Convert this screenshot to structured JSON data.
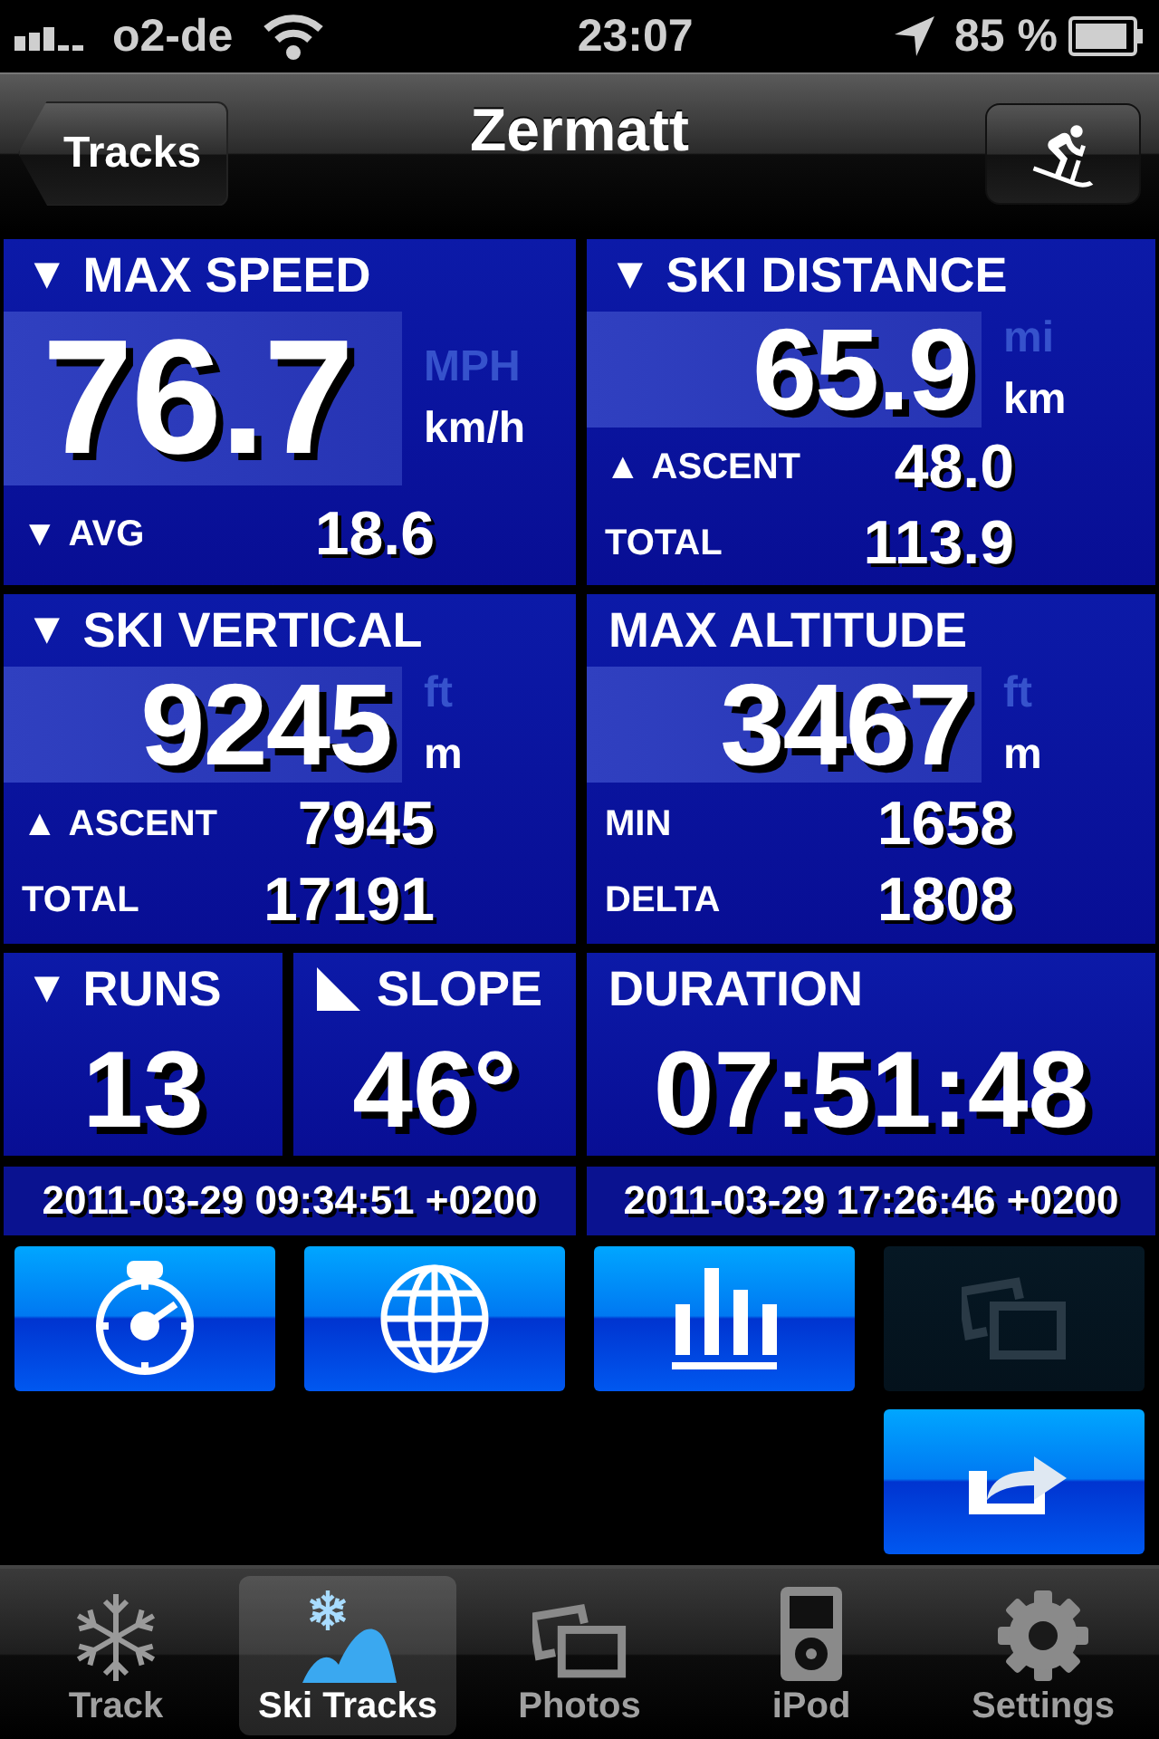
{
  "status_bar": {
    "carrier": "o2-de",
    "time": "23:07",
    "battery": "85 %"
  },
  "nav": {
    "back": "Tracks",
    "title": "Zermatt"
  },
  "stats": [
    {
      "marker": "▼",
      "title": "MAX SPEED",
      "value": "76.7",
      "units": [
        {
          "label": "MPH",
          "selected": false
        },
        {
          "label": "km/h",
          "selected": true
        }
      ],
      "rows": [
        {
          "marker": "▼",
          "label": "AVG",
          "value": "18.6"
        }
      ]
    },
    {
      "marker": "▼",
      "title": "SKI DISTANCE",
      "value": "65.9",
      "units": [
        {
          "label": "mi",
          "selected": false
        },
        {
          "label": "km",
          "selected": true
        }
      ],
      "rows": [
        {
          "marker": "▲",
          "label": "ASCENT",
          "value": "48.0"
        },
        {
          "label": "TOTAL",
          "value": "113.9"
        }
      ]
    },
    {
      "marker": "▼",
      "title": "SKI VERTICAL",
      "value": "9245",
      "units": [
        {
          "label": "ft",
          "selected": false
        },
        {
          "label": "m",
          "selected": true
        }
      ],
      "rows": [
        {
          "marker": "▲",
          "label": "ASCENT",
          "value": "7945"
        },
        {
          "label": "TOTAL",
          "value": "17191"
        }
      ]
    },
    {
      "title": "MAX ALTITUDE",
      "value": "3467",
      "units": [
        {
          "label": "ft",
          "selected": false
        },
        {
          "label": "m",
          "selected": true
        }
      ],
      "rows": [
        {
          "label": "MIN",
          "value": "1658"
        },
        {
          "label": "DELTA",
          "value": "1808"
        }
      ]
    }
  ],
  "small_stats": [
    {
      "marker": "▼",
      "title": "RUNS",
      "value": "13"
    },
    {
      "kind": "slope",
      "title": "SLOPE",
      "value": "46°"
    },
    {
      "title": "DURATION",
      "value": "07:51:48"
    }
  ],
  "dates": [
    "2011-03-29 09:34:51 +0200",
    "2011-03-29 17:26:46 +0200"
  ],
  "buttons": [
    {
      "kind": "stopwatch",
      "disabled": false
    },
    {
      "kind": "globe",
      "disabled": false
    },
    {
      "kind": "chart",
      "disabled": false
    },
    {
      "kind": "photos",
      "disabled": true
    },
    {
      "kind": "share",
      "disabled": false
    }
  ],
  "tabs": [
    {
      "kind": "snowflake",
      "label": "Track",
      "selected": false
    },
    {
      "kind": "skitracks",
      "label": "Ski Tracks",
      "selected": true
    },
    {
      "kind": "photos",
      "label": "Photos",
      "selected": false
    },
    {
      "kind": "ipod",
      "label": "iPod",
      "selected": false
    },
    {
      "kind": "settings",
      "label": "Settings",
      "selected": false
    }
  ]
}
